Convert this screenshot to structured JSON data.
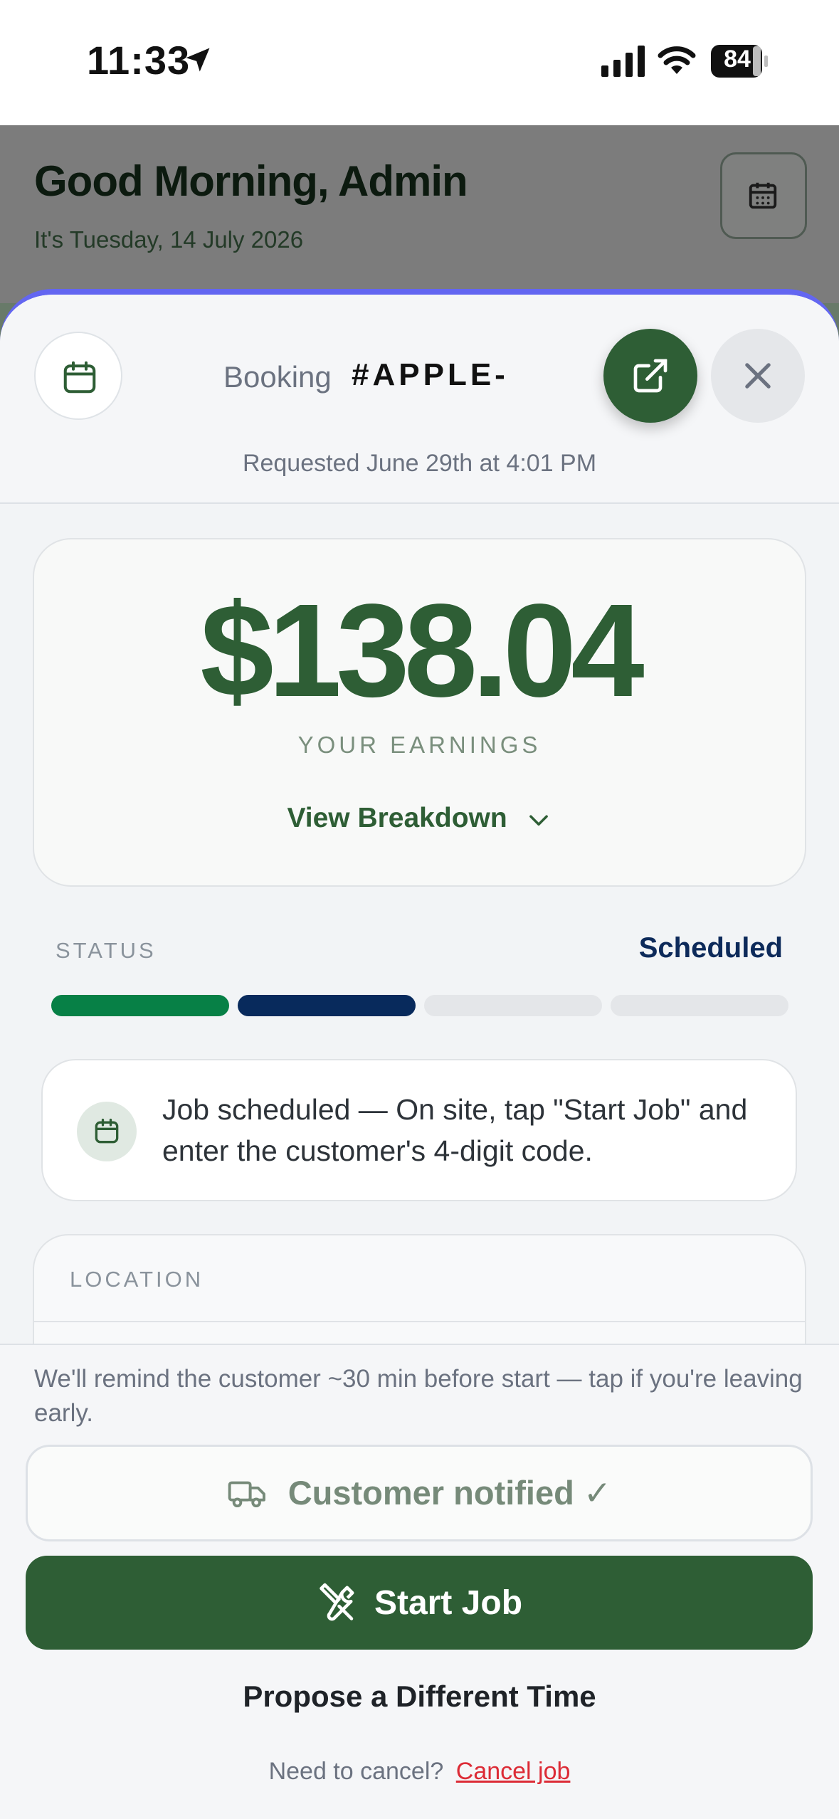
{
  "status_bar": {
    "time": "11:33",
    "battery": "84"
  },
  "background": {
    "greeting": "Good Morning, Admin",
    "date": "It's Tuesday, 14 July 2026"
  },
  "booking": {
    "label": "Booking",
    "id": "#APPLE-",
    "requested": "Requested June 29th at 4:01 PM"
  },
  "earnings": {
    "amount": "$138.04",
    "label": "YOUR EARNINGS",
    "breakdown": "View Breakdown"
  },
  "status": {
    "label": "STATUS",
    "value": "Scheduled",
    "steps_completed": 2,
    "steps_total": 4
  },
  "info": {
    "text": "Job scheduled — On site, tap \"Start Job\" and enter the customer's 4-digit code."
  },
  "location": {
    "label": "LOCATION"
  },
  "actions": {
    "reminder": "We'll remind the customer ~30 min before start — tap if you're leaving early.",
    "notified": "Customer notified ✓",
    "start": "Start Job",
    "propose": "Propose a Different Time",
    "cancel_prompt": "Need to cancel?",
    "cancel_link": "Cancel job"
  },
  "colors": {
    "brand_green": "#2e5e35",
    "accent": "#6366f1",
    "status_navy": "#0d2a5a",
    "danger": "#dc2b36"
  }
}
